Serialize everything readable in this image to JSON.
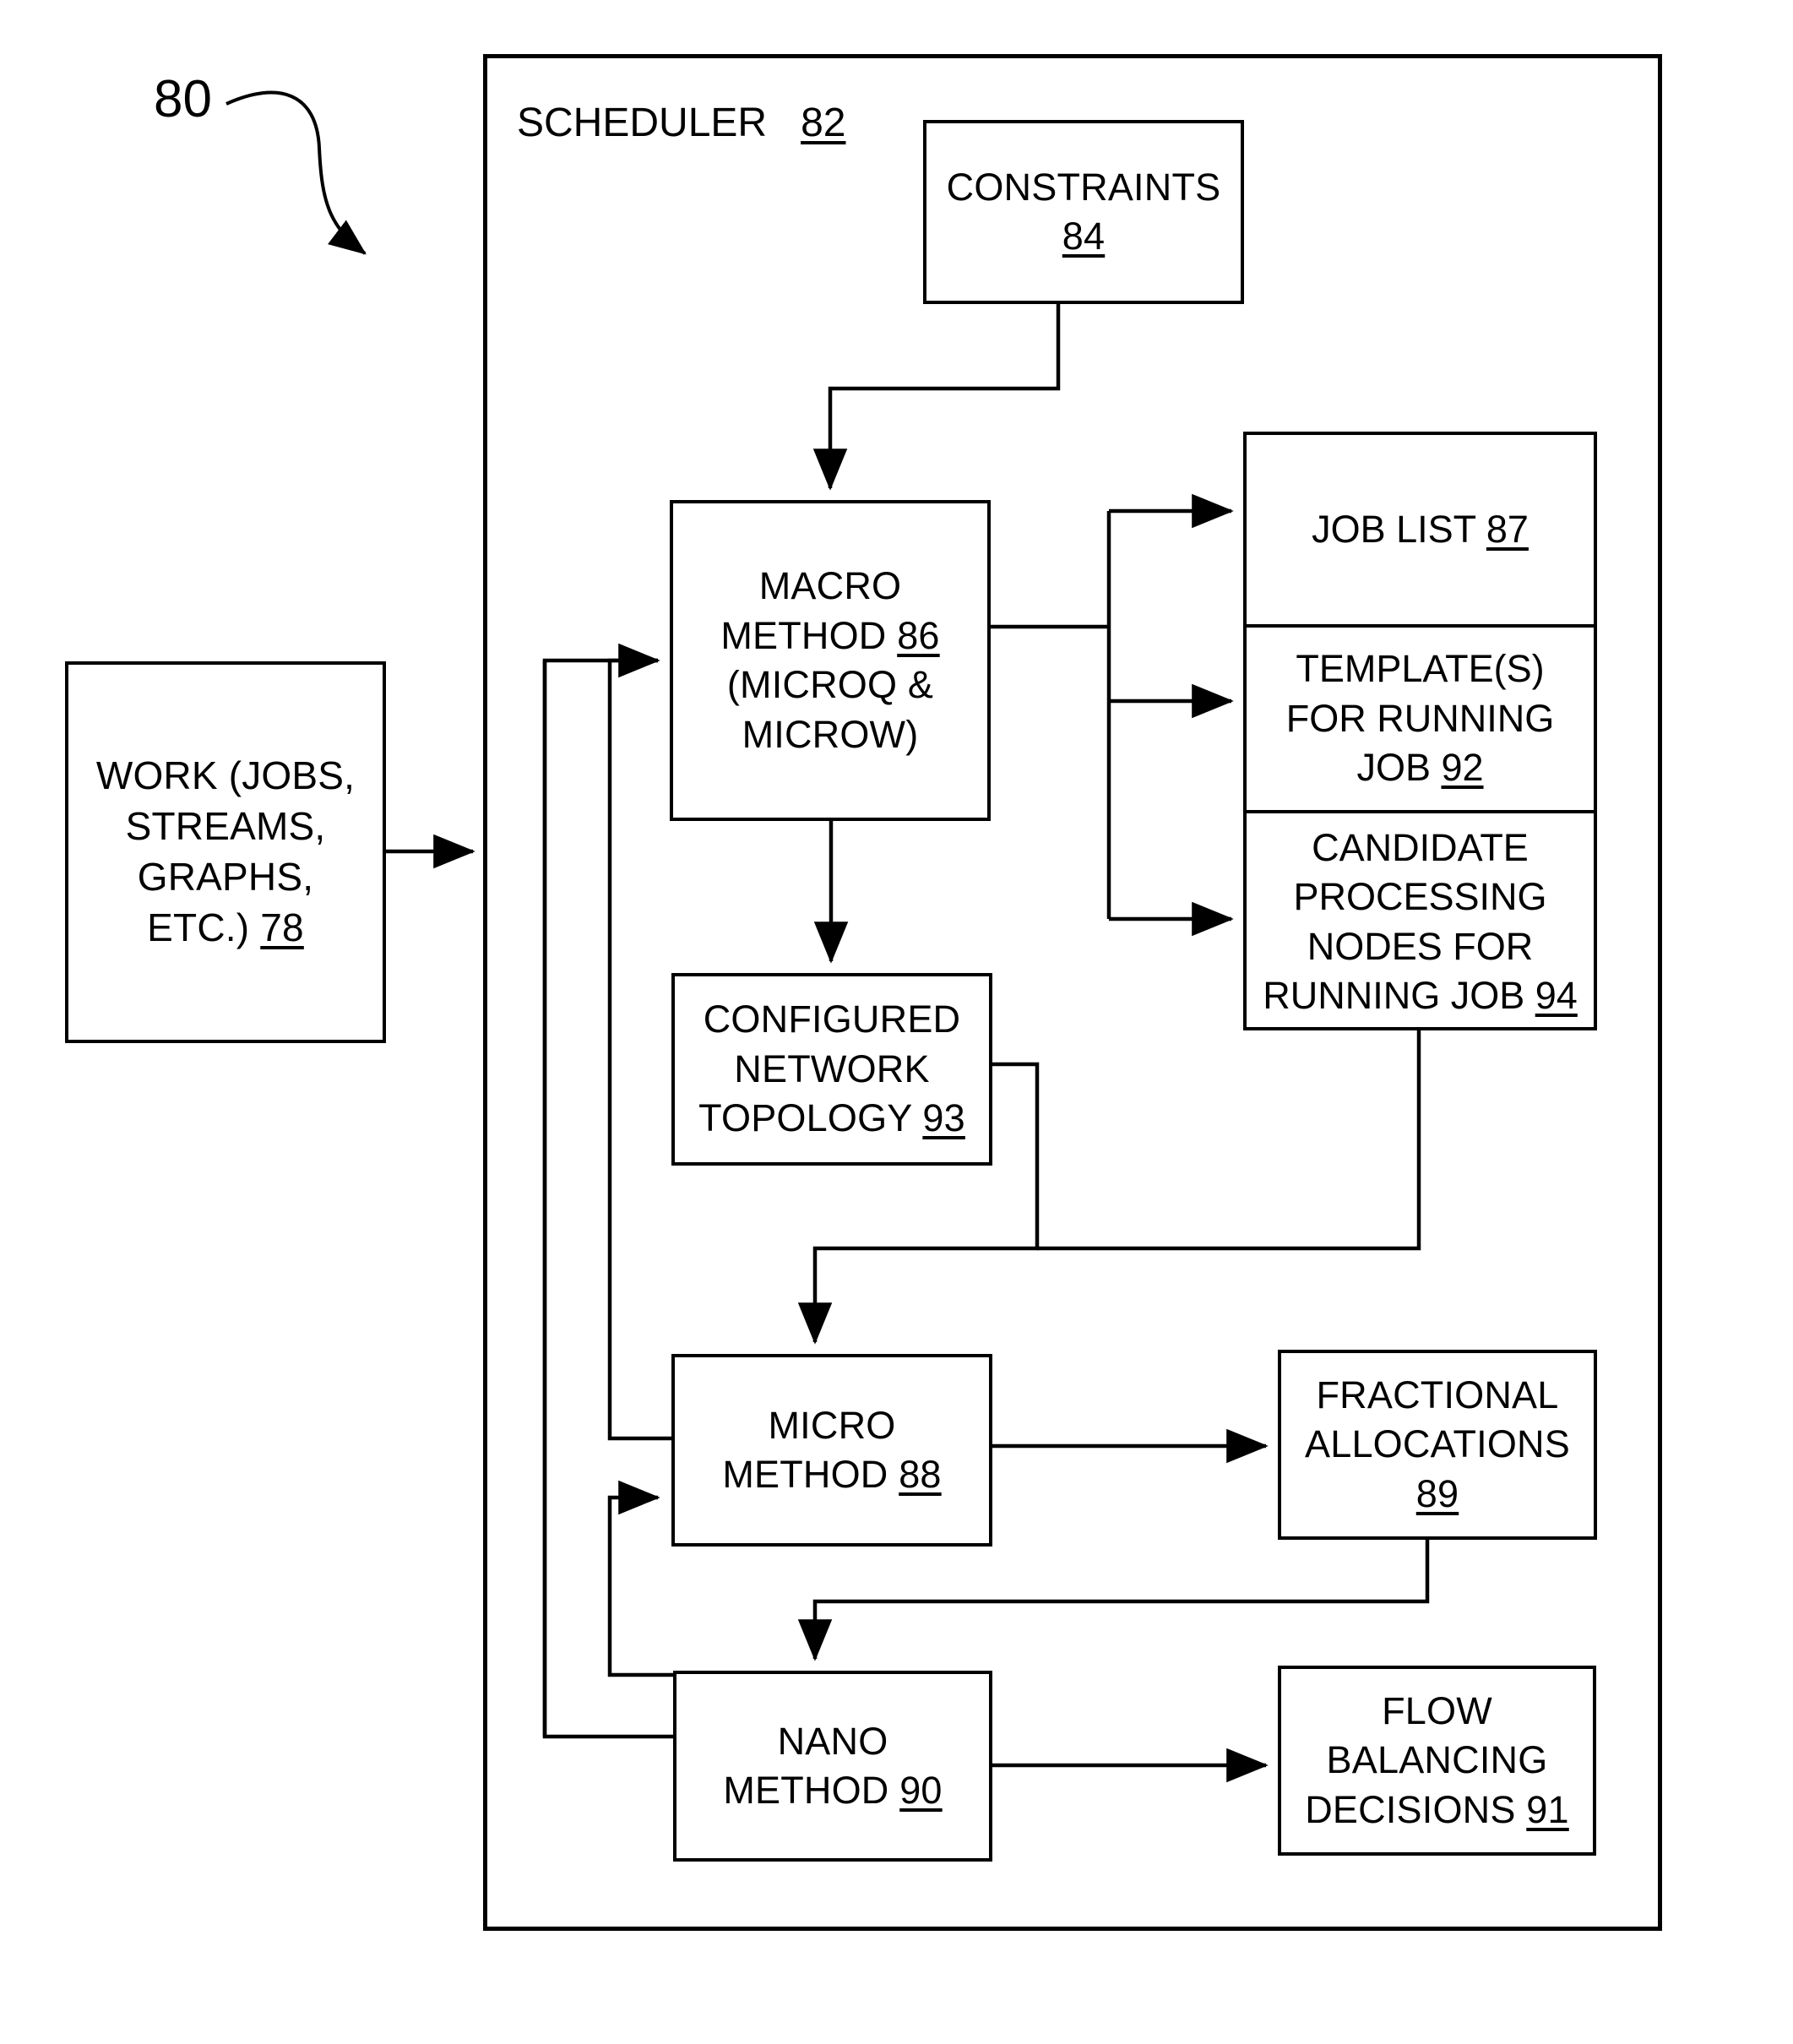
{
  "figure": {
    "ref_label": "80",
    "scheduler_label": "SCHEDULER",
    "scheduler_ref": "82"
  },
  "boxes": {
    "work": {
      "lines": [
        "WORK (JOBS,",
        "STREAMS,",
        "GRAPHS,",
        "ETC.) "
      ],
      "ref": "78"
    },
    "constraints": {
      "lines": [
        "CONSTRAINTS"
      ],
      "ref": "84"
    },
    "macro": {
      "lines": [
        "MACRO",
        "METHOD "
      ],
      "ref": "86",
      "tail": [
        "(MICROQ &",
        "MICROW)"
      ]
    },
    "topology": {
      "lines": [
        "CONFIGURED",
        "NETWORK",
        "TOPOLOGY "
      ],
      "ref": "93"
    },
    "micro": {
      "lines": [
        "MICRO",
        "METHOD "
      ],
      "ref": "88"
    },
    "nano": {
      "lines": [
        "NANO",
        "METHOD "
      ],
      "ref": "90"
    },
    "fractional": {
      "lines": [
        "FRACTIONAL",
        "ALLOCATIONS"
      ],
      "ref": "89"
    },
    "flow": {
      "lines": [
        "FLOW",
        "BALANCING",
        "DECISIONS "
      ],
      "ref": "91"
    },
    "job_list": {
      "lines": [
        "JOB LIST "
      ],
      "ref": "87"
    },
    "templates": {
      "lines": [
        "TEMPLATE(S)",
        "FOR RUNNING",
        "JOB "
      ],
      "ref": "92"
    },
    "candidate_nodes": {
      "lines": [
        "CANDIDATE",
        "PROCESSING",
        "NODES FOR",
        "RUNNING JOB "
      ],
      "ref": "94"
    }
  },
  "colors": {
    "stroke": "#000000",
    "background": "#ffffff"
  }
}
